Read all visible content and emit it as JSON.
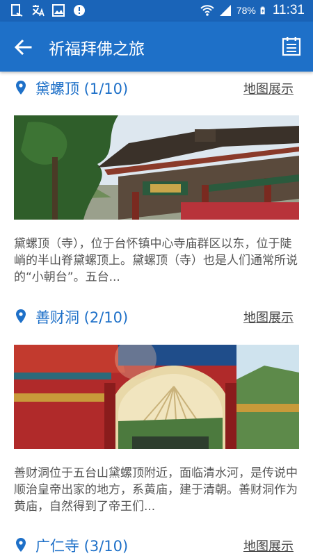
{
  "status_bar": {
    "battery": "78%",
    "time": "11:31"
  },
  "app_bar": {
    "title": "祈福拜佛之旅"
  },
  "spots": [
    {
      "name": "黛螺顶 (1/10)",
      "map_label": "地图展示",
      "description": "黛螺顶（寺），位于台怀镇中心寺庙群区以东，位于陡峭的半山脊黛螺顶上。黛螺顶（寺）也是人们通常所说的“小朝台”。五台..."
    },
    {
      "name": "善财洞 (2/10)",
      "map_label": "地图展示",
      "description": "善财洞位于五台山黛螺顶附近，面临清水河，是传说中顺治皇帝出家的地方，系黄庙，建于清朝。善财洞作为黄庙，自然得到了帝王们..."
    },
    {
      "name": "广仁寺 (3/10)",
      "map_label": "地图展示"
    }
  ],
  "icons": {
    "back": "arrow-left-icon",
    "calendar": "calendar-icon",
    "pin": "location-pin-icon"
  },
  "colors": {
    "status_bar": "#1a64b8",
    "app_bar": "#1e70c8",
    "accent": "#1e70c8"
  }
}
